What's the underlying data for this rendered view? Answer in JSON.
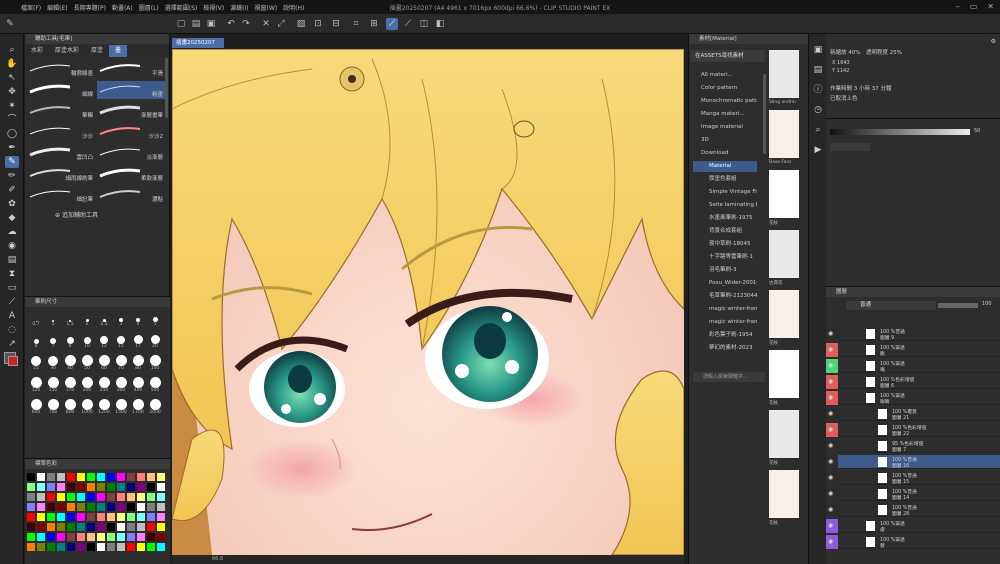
{
  "window": {
    "title": "插畫20250207 (A4 4961 x 7016px 600dpi 66.6%) - CLIP STUDIO PAINT EX",
    "menu": [
      "檔案(F)",
      "編輯(E)",
      "長期專題(P)",
      "動畫(A)",
      "圖層(L)",
      "選擇範圍(S)",
      "檢視(V)",
      "濾鏡(I)",
      "視窗(W)",
      "說明(H)"
    ]
  },
  "subtool": {
    "header": "輔助工具[毛筆]",
    "tabs": [
      "水彩",
      "厚塗水彩",
      "厚塗",
      "墨"
    ],
    "brushes": [
      {
        "label": "輪廓線墨"
      },
      {
        "label": "平滑"
      },
      {
        "label": "細線"
      },
      {
        "label": "粉墨"
      },
      {
        "label": "筆觸"
      },
      {
        "label": "漸層畫筆"
      },
      {
        "label": "沙沙"
      },
      {
        "label": "沙沙2"
      },
      {
        "label": "雲凹凸"
      },
      {
        "label": "淡漸層"
      },
      {
        "label": "細雨線刷筆"
      },
      {
        "label": "柔軟漸層"
      },
      {
        "label": "細記筆"
      },
      {
        "label": "濃點"
      }
    ],
    "add_tool": "追加輔助工具"
  },
  "brushsize": {
    "header": "筆刷尺寸",
    "sizes": [
      "0.7",
      "1",
      "1.5",
      "2",
      "2.5",
      "3",
      "4",
      "5",
      "6",
      "7",
      "8",
      "10",
      "12",
      "15",
      "17",
      "20",
      "25",
      "30",
      "40",
      "50",
      "60",
      "70",
      "80",
      "100",
      "120",
      "150",
      "170",
      "200",
      "250",
      "300",
      "400",
      "500",
      "600",
      "700",
      "800",
      "1000",
      "1200",
      "1500",
      "1700",
      "2000"
    ]
  },
  "colorset": {
    "header": "標準色彩",
    "colors": [
      "#000000",
      "#ffffff",
      "#808080",
      "#c0c0c0",
      "#ff0000",
      "#ffff00",
      "#00ff00",
      "#00ffff",
      "#0000ff",
      "#ff00ff",
      "#804040",
      "#ff8080",
      "#ffc080",
      "#ffff80",
      "#80ff80",
      "#80ffff",
      "#8080ff",
      "#ff80ff",
      "#400000",
      "#800000",
      "#ff8000",
      "#808000",
      "#008000",
      "#008080",
      "#000080",
      "#800080"
    ]
  },
  "canvas": {
    "tab": "插畫20250207",
    "status": "66.6"
  },
  "material": {
    "header": "素材[Material]",
    "top_button": "在ASSETS尋找素材",
    "tree": [
      "All materi...",
      "Color pattern",
      "Monochromatic patte",
      "Manga materi...",
      "Image material",
      "3D",
      "Download",
      "Material",
      "厚塗色套組",
      "Simple Vintage Fr",
      "Seite laminating br",
      "水墨風筆刷-1975",
      "背景合成套組",
      "夜中草刷-18045",
      "十字路等雲筆刷-1",
      "羽毛筆刷-3",
      "Poxu_Wider-20016",
      "毛草筆刷-2123044",
      "magic winter-frame",
      "magic winter-frame2",
      "彩色葉子刷-1954",
      "夢幻的素材-2023"
    ],
    "thumbs": [
      "Sling andrei",
      "Base Fans",
      "花紋",
      "古典花",
      "花紋",
      "花紋",
      "花紋",
      "花紋"
    ],
    "search_placeholder": "請輸入檢索關鍵字..."
  },
  "info": {
    "zoom_label": "新縮放 40%",
    "opacity_label": "透明程度 25%",
    "x_label": "X 1643",
    "y_label": "Y 1142",
    "time_label": "作業時間 3 小時 37 分鐘",
    "status_label": "已取消上色"
  },
  "layers": {
    "header": "圖層",
    "blend": "普通",
    "opacity": "100",
    "rows": [
      {
        "pct": "100 %普通",
        "name": "圖層 9"
      },
      {
        "pct": "100 %穿透",
        "name": "臉"
      },
      {
        "pct": "100 %穿透",
        "name": "嘴"
      },
      {
        "pct": "100 %色彩增值",
        "name": "圖層 6"
      },
      {
        "pct": "100 %穿透",
        "name": "眼睛"
      },
      {
        "pct": "100 %覆蓋",
        "name": "圖層 21"
      },
      {
        "pct": "100 %色彩增值",
        "name": "圖層 22"
      },
      {
        "pct": "95 %色彩增值",
        "name": "圖層 7"
      },
      {
        "pct": "100 %普通",
        "name": "圖層 16"
      },
      {
        "pct": "100 %普通",
        "name": "圖層 15"
      },
      {
        "pct": "100 %普通",
        "name": "圖層 14"
      },
      {
        "pct": "100 %普通",
        "name": "圖層 28"
      },
      {
        "pct": "100 %穿透",
        "name": "膚"
      },
      {
        "pct": "100 %穿透",
        "name": "髮"
      }
    ]
  }
}
